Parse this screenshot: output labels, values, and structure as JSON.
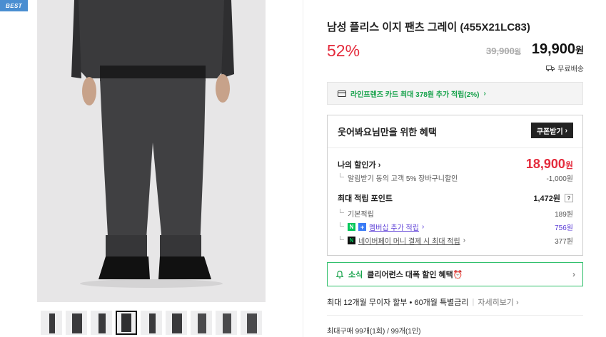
{
  "badge": "BEST",
  "product": {
    "title": "남성 플리스 이지 팬츠 그레이 (455X21LC83)",
    "discount": "52%",
    "original_price": "39,900",
    "original_unit": "원",
    "price": "19,900",
    "price_unit": "원",
    "shipping": "무료배송"
  },
  "card_promo": "라인프렌즈 카드 최대 378원 추가 적립(2%)",
  "benefit": {
    "header": "웃어봐요님만을 위한 혜택",
    "coupon_button": "쿠폰받기",
    "my_price_label": "나의 할인가",
    "my_price": "18,900",
    "my_price_unit": "원",
    "discount_item_label": "알림받기 동의 고객 5% 장바구니할인",
    "discount_item_value": "-1,000원",
    "points_label": "최대 적립 포인트",
    "points_value": "1,472원",
    "points_help": "?",
    "basic_label": "기본적립",
    "basic_value": "189원",
    "membership_label": "멤버십 추가 적립",
    "membership_value": "756원",
    "naverpay_label": "네이버페이 머니 결제 시 최대 적립",
    "naverpay_value": "377원"
  },
  "news": {
    "tag": "소식",
    "text": "클리어런스 대폭 할인 혜택⏰"
  },
  "installment": {
    "text": "최대 12개월 무이자 할부 • 60개월 특별금리",
    "more": "자세히보기"
  },
  "max_purchase": "최대구매 99개(1회) / 99개(1인)",
  "colors": {
    "sale_red": "#e42b3c",
    "naver_green": "#17a24b",
    "badge_blue": "#4a8ed1",
    "purple_link": "#5b3dd6"
  }
}
